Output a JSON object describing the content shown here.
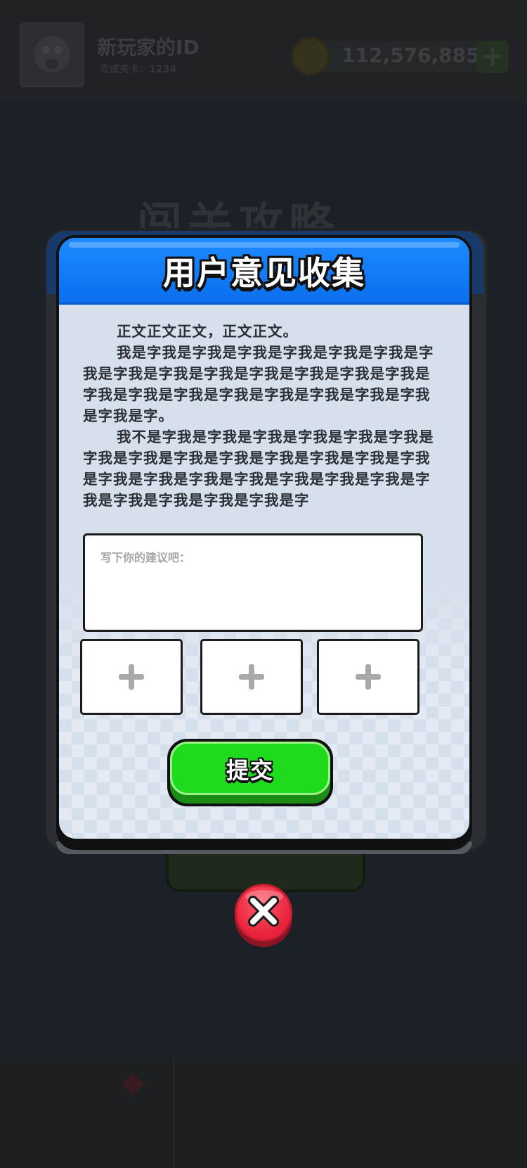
{
  "background": {
    "player_name": "新玩家的ID",
    "player_progress": "完成关卡：1234",
    "coin_count": "112,576,885",
    "add_coins_symbol": "+",
    "page_title_partial": "闯关攻略"
  },
  "modal": {
    "title": "用户意见收集",
    "paragraphs": [
      "正文正文正文，正文正文。",
      "我是字我是字我是字我是字我是字我是字我是字我是字我是字我是字我是字我是字我是字我是字我是字我是字我是字我是字我是字我是字我是字我是字我是字我是字。",
      "我不是字我是字我是字我是字我是字我是字我是字我是字我是字我是字我是字我是字我是字我是字我是字我是字我是字我是字我是字我是字我是字我是字我是字我是字我是字我是字我是字"
    ],
    "suggestion_placeholder": "写下你的建议吧：",
    "upload_slots": [
      {
        "icon": "plus-icon"
      },
      {
        "icon": "plus-icon"
      },
      {
        "icon": "plus-icon"
      }
    ],
    "submit_label": "提交"
  },
  "close_button": {
    "icon": "close-x-icon"
  },
  "colors": {
    "header_blue": "#0a6fee",
    "submit_green": "#1fdb1d",
    "close_red": "#e8233b",
    "panel_bg": "#d6dfec"
  }
}
